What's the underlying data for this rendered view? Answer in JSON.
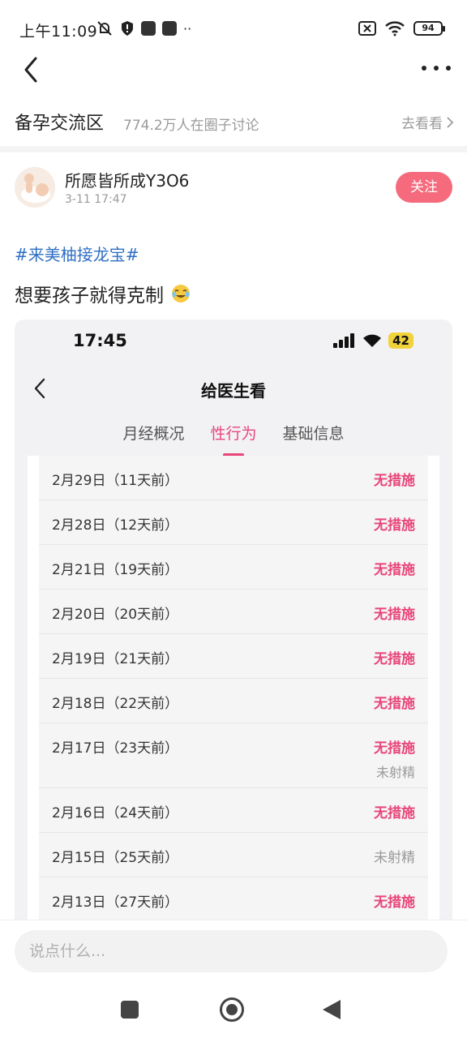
{
  "status_bar": {
    "time": "上午11:09",
    "battery": "94"
  },
  "circle": {
    "name": "备孕交流区",
    "count": "774.2万人在圈子讨论",
    "go_label": "去看看"
  },
  "post": {
    "author": "所愿皆所成Y3O6",
    "time": "3-11 17:47",
    "follow_label": "关注",
    "hashtag": "#来美柚接龙宝#",
    "text": "想要孩子就得克制"
  },
  "embedded": {
    "time": "17:45",
    "battery": "42",
    "title": "给医生看",
    "tabs": [
      {
        "label": "月经概况",
        "active": false
      },
      {
        "label": "性行为",
        "active": true
      },
      {
        "label": "基础信息",
        "active": false
      }
    ],
    "rows": [
      {
        "date": "2月29日（11天前）",
        "status": "无措施",
        "sub": ""
      },
      {
        "date": "2月28日（12天前）",
        "status": "无措施",
        "sub": ""
      },
      {
        "date": "2月21日（19天前）",
        "status": "无措施",
        "sub": ""
      },
      {
        "date": "2月20日（20天前）",
        "status": "无措施",
        "sub": ""
      },
      {
        "date": "2月19日（21天前）",
        "status": "无措施",
        "sub": ""
      },
      {
        "date": "2月18日（22天前）",
        "status": "无措施",
        "sub": ""
      },
      {
        "date": "2月17日（23天前）",
        "status": "无措施",
        "sub": "未射精"
      },
      {
        "date": "2月16日（24天前）",
        "status": "无措施",
        "sub": ""
      },
      {
        "date": "2月15日（25天前）",
        "status": "未射精",
        "sub": ""
      },
      {
        "date": "2月13日（27天前）",
        "status": "无措施",
        "sub": ""
      }
    ]
  },
  "comment": {
    "placeholder": "说点什么..."
  },
  "colors": {
    "accent": "#e8457a",
    "follow": "#f56a7d",
    "hashtag": "#2f6fc4"
  }
}
